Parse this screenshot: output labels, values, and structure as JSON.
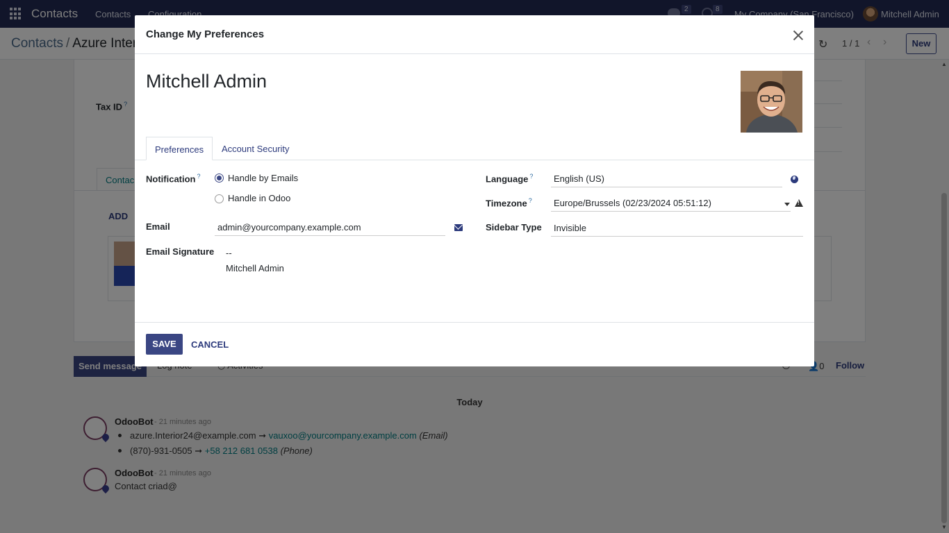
{
  "navbar": {
    "app_name": "Contacts",
    "menu": [
      "Contacts",
      "Configuration"
    ],
    "messages_count": "2",
    "activities_count": "8",
    "company": "My Company (San Francisco)",
    "user": "Mitchell Admin"
  },
  "control_panel": {
    "breadcrumb_root": "Contacts",
    "breadcrumb_sep": "/",
    "breadcrumb_current": "Azure Inter",
    "pager": "1 / 1",
    "new_label": "New"
  },
  "background_form": {
    "tax_id_label": "Tax ID",
    "tab_label": "Contac",
    "add_label": "ADD"
  },
  "chatter": {
    "send_message": "Send message",
    "log_note": "Log note",
    "activities": "Activities",
    "follower_count": "0",
    "follow": "Follow",
    "today": "Today",
    "messages": [
      {
        "author": "OdooBot",
        "time": "- 21 minutes ago",
        "changes": [
          {
            "old": "azure.Interior24@example.com",
            "new": "vauxoo@yourcompany.example.com",
            "field": "(Email)"
          },
          {
            "old": "(870)-931-0505",
            "new": "+58 212 681 0538",
            "field": "(Phone)"
          }
        ]
      },
      {
        "author": "OdooBot",
        "time": "- 21 minutes ago",
        "body": "Contact criad@"
      }
    ]
  },
  "modal": {
    "title": "Change My Preferences",
    "user_name": "Mitchell Admin",
    "tabs": [
      "Preferences",
      "Account Security"
    ],
    "notification_label": "Notification",
    "notification_options": [
      "Handle by Emails",
      "Handle in Odoo"
    ],
    "notification_selected": "Handle by Emails",
    "email_label": "Email",
    "email_value": "admin@yourcompany.example.com",
    "signature_label": "Email Signature",
    "signature_lines": [
      "--",
      "Mitchell Admin"
    ],
    "language_label": "Language",
    "language_value": "English (US)",
    "timezone_label": "Timezone",
    "timezone_value": "Europe/Brussels (02/23/2024 05:51:12)",
    "sidebar_type_label": "Sidebar Type",
    "sidebar_type_value": "Invisible",
    "help_marker": "?",
    "save_label": "SAVE",
    "cancel_label": "CANCEL"
  },
  "colors": {
    "navbar": "#222a54",
    "primary": "#3a4683",
    "link": "#017e84"
  }
}
